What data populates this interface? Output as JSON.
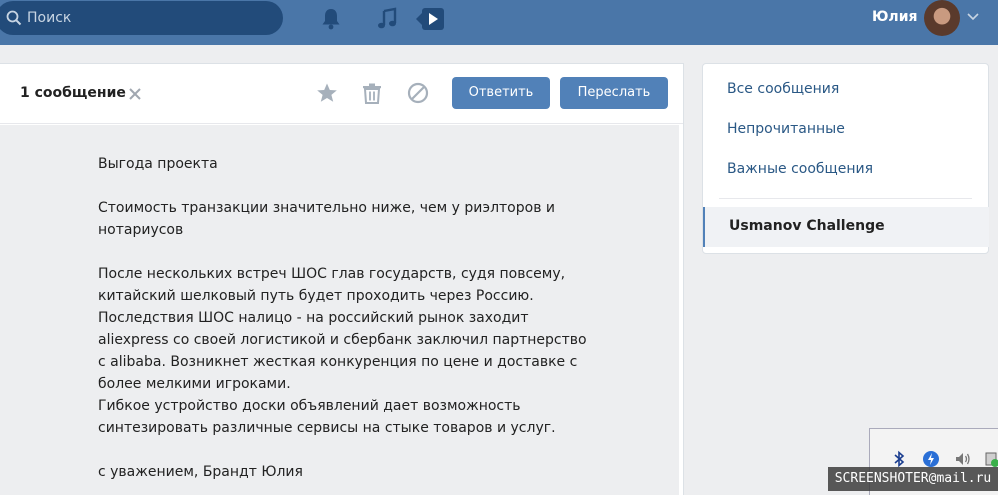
{
  "header": {
    "search_placeholder": "Поиск",
    "user_name": "Юлия",
    "icons": [
      "search-icon",
      "bell-icon",
      "music-icon",
      "video-play-icon",
      "chevron-down-icon"
    ]
  },
  "message_panel": {
    "count_label": "1 сообщение",
    "reply_button": "Ответить",
    "forward_button": "Переслать",
    "body_text": "Выгода проекта\n\nСтоимость транзакции значительно ниже, чем у риэлторов и нотариусов\n\nПосле нескольких встреч ШОС глав государств, судя повсему, китайский шелковый путь будет проходить через Россию.\nПоследствия ШОС налицо - на российский рынок заходит aliexpress со своей логистикой и сбербанк заключил партнерство с alibaba. Возникнет жесткая конкуренция по цене и доставке с более мелкими игроками.\nГибкое устройство доски объявлений дает возможность синтезировать различные сервисы на стыке товаров и услуг.\n\nс уважением, Брандт Юлия"
  },
  "nav": {
    "items": [
      "Все сообщения",
      "Непрочитанные",
      "Важные сообщения"
    ],
    "active_chat": "Usmanov Challenge"
  },
  "colors": {
    "topbar": "#4a76a8",
    "button": "#5181b8",
    "link": "#2a5885"
  },
  "watermark": {
    "text": "SCREENSHOTER@mail.ru"
  }
}
